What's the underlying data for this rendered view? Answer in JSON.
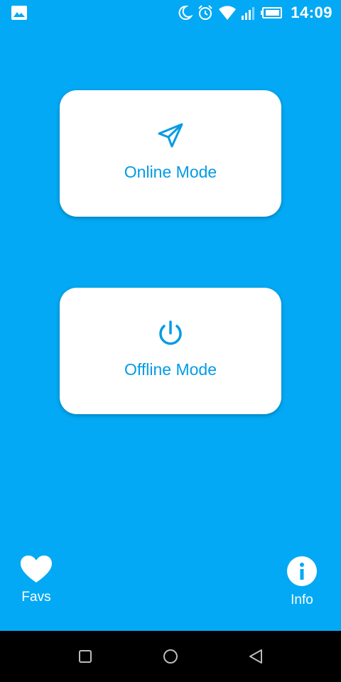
{
  "status_bar": {
    "time": "14:09",
    "icons": [
      "gallery-icon",
      "moon-icon",
      "alarm-icon",
      "wifi-icon",
      "signal-icon",
      "battery-icon"
    ]
  },
  "modes": {
    "online": {
      "label": "Online Mode",
      "icon": "paper-plane-icon"
    },
    "offline": {
      "label": "Offline Mode",
      "icon": "power-icon"
    }
  },
  "bottom": {
    "favs": {
      "label": "Favs",
      "icon": "heart-icon"
    },
    "info": {
      "label": "Info",
      "icon": "info-icon"
    }
  },
  "nav": {
    "icons": [
      "recents-icon",
      "home-icon",
      "back-icon"
    ]
  },
  "colors": {
    "background": "#03A9F4",
    "card": "#FFFFFF",
    "accent": "#039BE5",
    "nav_bar": "#000000"
  }
}
